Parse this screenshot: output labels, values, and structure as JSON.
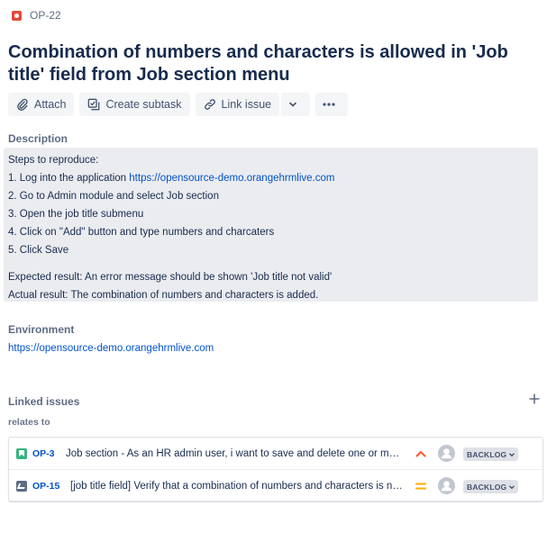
{
  "issue": {
    "key": "OP-22",
    "type_icon": "bug-icon",
    "title": "Combination of numbers and characters is allowed in 'Job title' field from Job section menu"
  },
  "toolbar": {
    "attach_label": "Attach",
    "create_subtask_label": "Create subtask",
    "link_issue_label": "Link issue"
  },
  "description": {
    "label": "Description",
    "steps_heading": "Steps to reproduce:",
    "step1_prefix": "1. Log into the application ",
    "step1_link": "https://opensource-demo.orangehrmlive.com",
    "step2": "2. Go to Admin module and select Job section",
    "step3": "3. Open the job title submenu",
    "step4": "4. Click on \"Add\" button and type numbers and charcaters",
    "step5": "5. Click Save",
    "expected": "Expected result: An error message should be shown 'Job title not valid'",
    "actual": "Actual result: The combination of numbers and characters is added."
  },
  "environment": {
    "label": "Environment",
    "link": "https://opensource-demo.orangehrmlive.com"
  },
  "linked_issues": {
    "label": "Linked issues",
    "relation": "relates to",
    "items": [
      {
        "key": "OP-3",
        "type_icon": "story-icon",
        "summary": "Job section - As an HR admin user, i want to save and delete one or more job titles",
        "priority_icon": "priority-high-icon",
        "status": "BACKLOG"
      },
      {
        "key": "OP-15",
        "type_icon": "task-icon",
        "summary": "[job title field] Verify that a combination of numbers and characters is not allowed",
        "priority_icon": "priority-medium-icon",
        "status": "BACKLOG"
      }
    ]
  },
  "colors": {
    "link": "#0052cc",
    "bug": "#e5493a",
    "story": "#36b37e",
    "priority_high": "#ff5630",
    "priority_medium": "#ffab00",
    "description_bg": "#ebecf0"
  }
}
